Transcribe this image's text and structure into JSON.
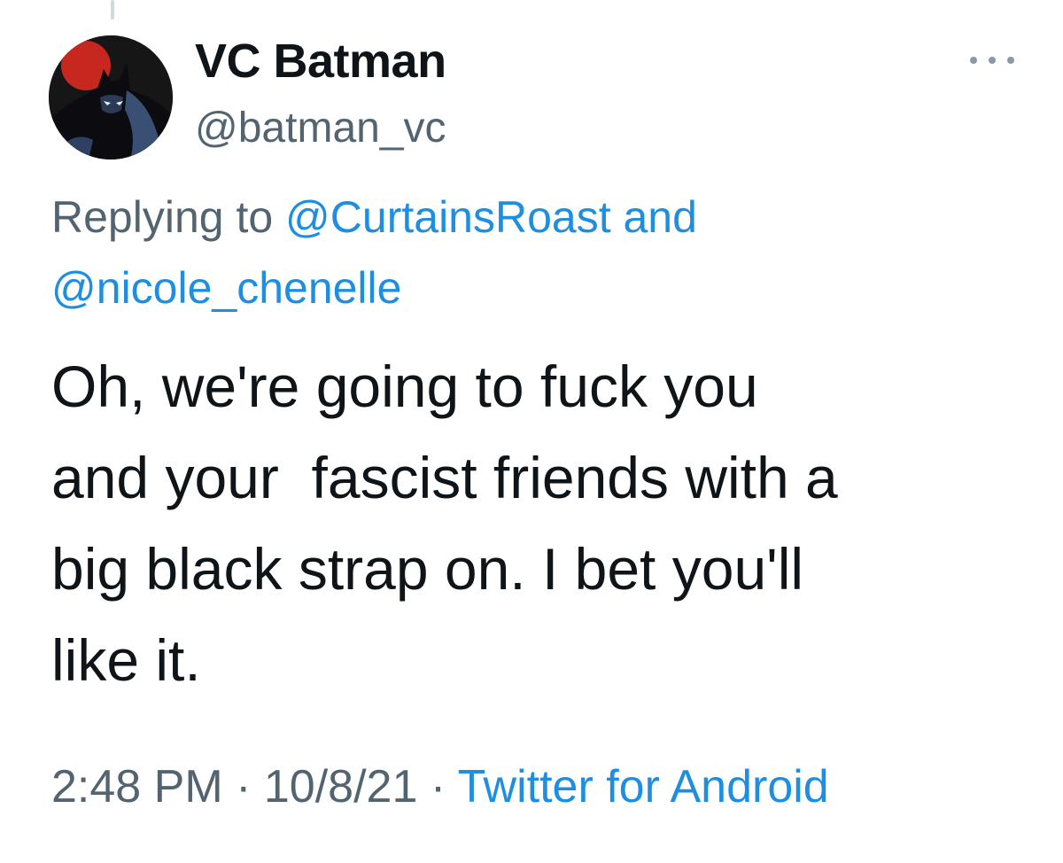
{
  "tweet": {
    "author": {
      "display_name": "VC Batman",
      "handle": "@batman_vc",
      "avatar_icon": "batman-avatar-icon"
    },
    "more_icon": "more-dots-icon",
    "reply_context": {
      "prefix": "Replying to ",
      "mention_1": "@CurtainsRoast",
      "conjunction": " and ",
      "mention_2": "@nicole_chenelle"
    },
    "text_lines": [
      "Oh, we're going to fuck you",
      "and your  fascist friends with a",
      "big black strap on. I bet you'll",
      "like it."
    ],
    "time": "2:48 PM",
    "separator": " · ",
    "date": "10/8/21",
    "source": "Twitter for Android"
  },
  "colors": {
    "text_primary": "#0f1419",
    "text_secondary": "#536471",
    "link": "#1d8ee0",
    "background": "#ffffff"
  }
}
